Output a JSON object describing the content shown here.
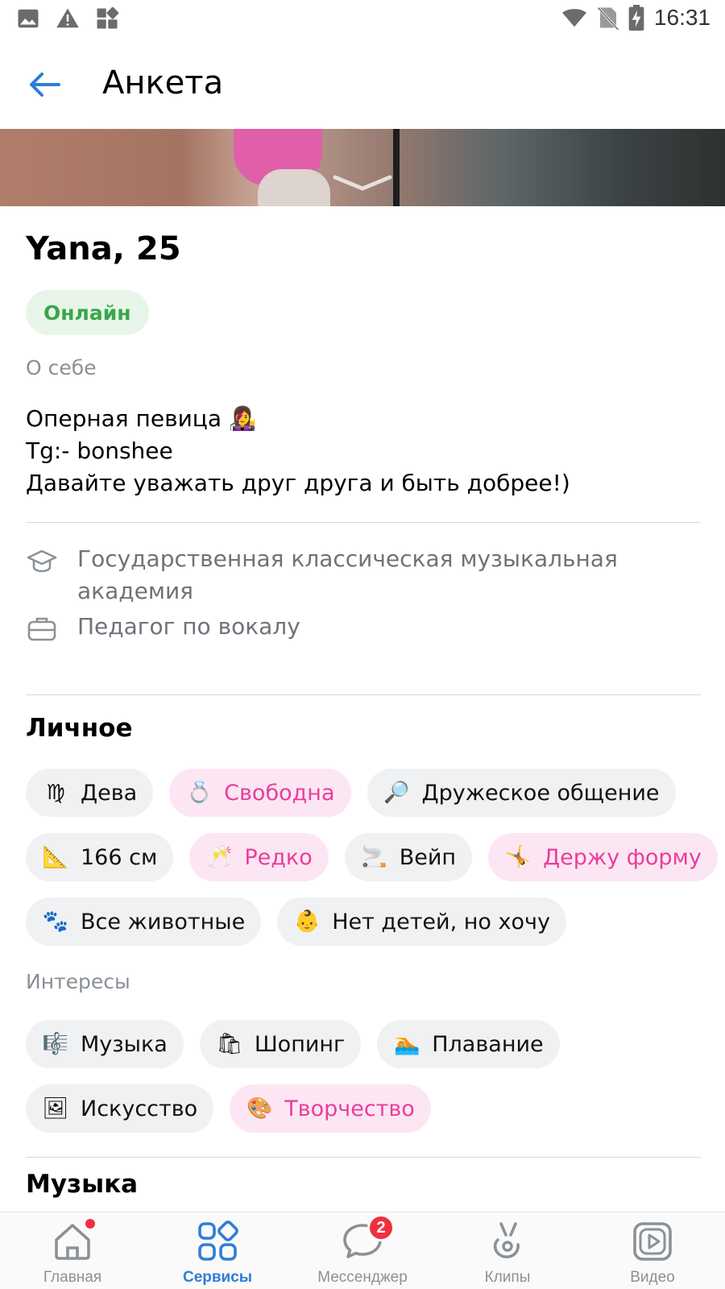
{
  "status_bar": {
    "time": "16:31",
    "left_icons": [
      "image-icon",
      "warning-icon",
      "apps-icon"
    ],
    "right_icons": [
      "wifi-icon",
      "no-sim-icon",
      "battery-charging-icon"
    ]
  },
  "header": {
    "title": "Анкета",
    "back_icon": "arrow-left-icon"
  },
  "profile": {
    "name_age": "Yana, 25",
    "status": "Онлайн",
    "about_label": "О себе",
    "about_lines": [
      "Оперная певица 👩‍🎤",
      "Tg:- bonshee",
      "Давайте уважать друг друга и быть добрее!)"
    ],
    "education": "Государственная классическая музыкальная академия",
    "job": "Педагог по вокалу"
  },
  "personal": {
    "title": "Личное",
    "chips": [
      {
        "emoji": "♍",
        "label": "Дева",
        "highlight": false
      },
      {
        "emoji": "💍",
        "label": "Свободна",
        "highlight": true
      },
      {
        "emoji": "🔎",
        "label": "Дружеское общение",
        "highlight": false
      },
      {
        "emoji": "📐",
        "label": "166 см",
        "highlight": false
      },
      {
        "emoji": "🥂",
        "label": "Редко",
        "highlight": true
      },
      {
        "emoji": "🚬",
        "label": "Вейп",
        "highlight": false
      },
      {
        "emoji": "🤸",
        "label": "Держу форму",
        "highlight": true
      },
      {
        "emoji": "🐾",
        "label": "Все животные",
        "highlight": false
      },
      {
        "emoji": "👶",
        "label": "Нет детей, но хочу",
        "highlight": false
      }
    ]
  },
  "interests": {
    "label": "Интересы",
    "chips": [
      {
        "emoji": "🎼",
        "label": "Музыка",
        "highlight": false
      },
      {
        "emoji": "🛍",
        "label": "Шопинг",
        "highlight": false
      },
      {
        "emoji": "🏊",
        "label": "Плавание",
        "highlight": false
      },
      {
        "emoji": "🖼",
        "label": "Искусство",
        "highlight": false
      },
      {
        "emoji": "🎨",
        "label": "Творчество",
        "highlight": true
      }
    ]
  },
  "music": {
    "title": "Музыка"
  },
  "bottom_nav": {
    "items": [
      {
        "label": "Главная",
        "icon": "home-icon",
        "active": false,
        "dot": true
      },
      {
        "label": "Сервисы",
        "icon": "services-icon",
        "active": true
      },
      {
        "label": "Мессенджер",
        "icon": "messenger-icon",
        "active": false,
        "badge": "2"
      },
      {
        "label": "Клипы",
        "icon": "clips-icon",
        "active": false
      },
      {
        "label": "Видео",
        "icon": "video-icon",
        "active": false
      }
    ]
  },
  "colors": {
    "accent": "#2f7ed8",
    "online_green": "#3aa649",
    "highlight_pink": "#e83e9c",
    "badge_red": "#ef2f3d"
  }
}
